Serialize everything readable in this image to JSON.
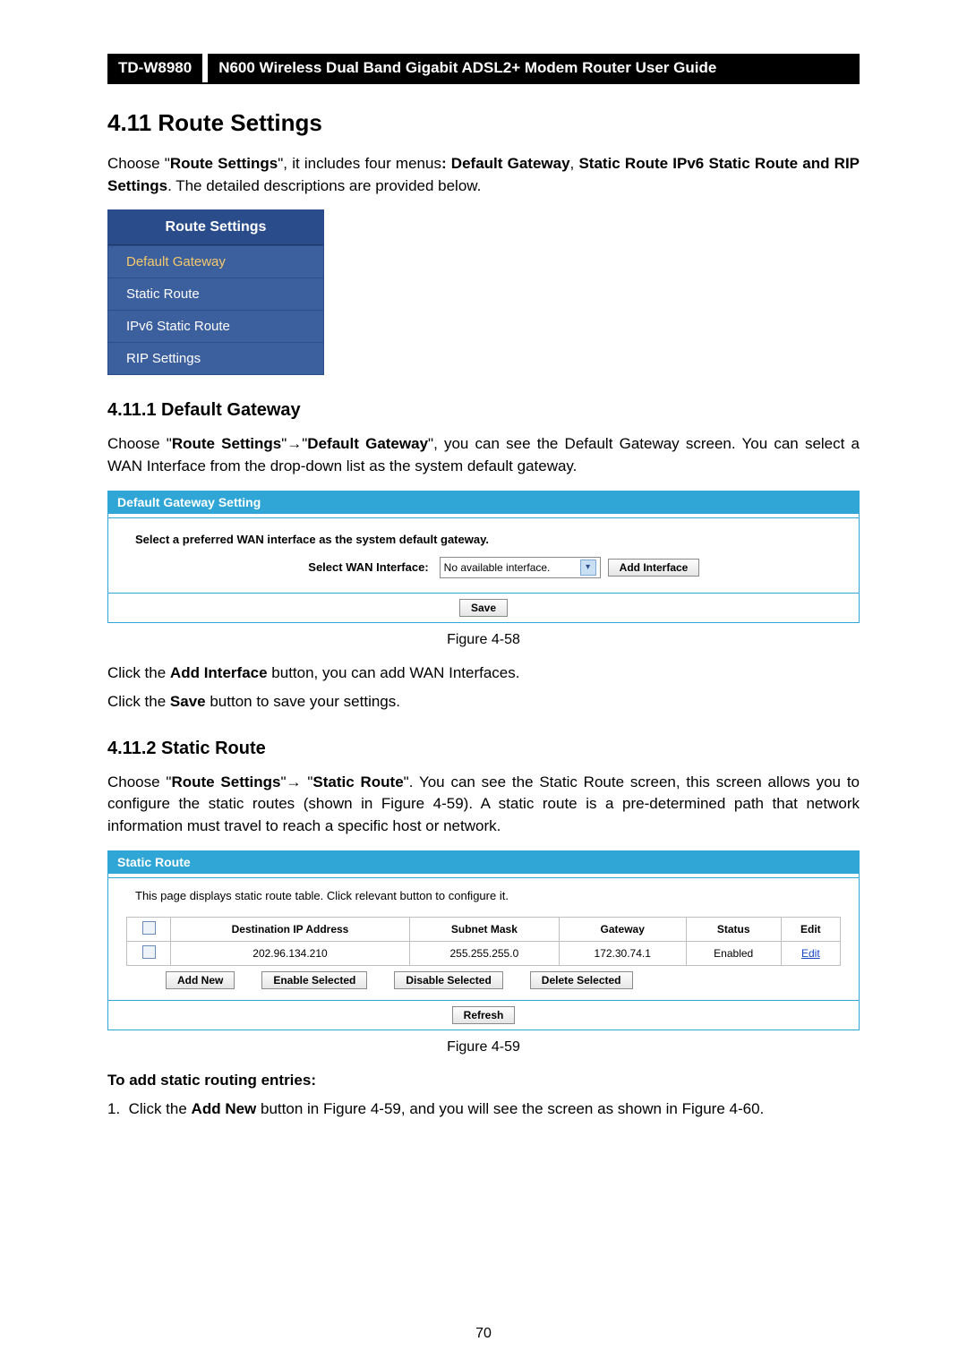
{
  "header": {
    "model": "TD-W8980",
    "title": "N600 Wireless Dual Band Gigabit ADSL2+ Modem Router User Guide"
  },
  "section_title": "4.11  Route Settings",
  "intro": {
    "pre": "Choose \"",
    "rs": "Route Settings",
    "mid": "\", it includes four menus",
    "boldlist": ": Default Gateway",
    "mid2": ", ",
    "boldlist2": "Static Route IPv6 Static Route and RIP Settings",
    "post": ". The detailed descriptions are provided below."
  },
  "nav": {
    "head": "Route Settings",
    "items": [
      "Default Gateway",
      "Static Route",
      "IPv6 Static Route",
      "RIP Settings"
    ],
    "selected": 0
  },
  "sub1": {
    "heading": "4.11.1 Default Gateway",
    "p1a": "Choose \"",
    "p1b": "Route Settings",
    "p1c": "\"→\"",
    "p1d": "Default Gateway",
    "p1e": "\", you can see the Default Gateway screen. You can select a WAN Interface from the drop-down list as the system default gateway."
  },
  "dg_panel": {
    "title": "Default Gateway Setting",
    "instruction": "Select a preferred WAN interface as the system default gateway.",
    "select_label": "Select WAN Interface:",
    "dropdown_value": "No available interface.",
    "add_interface": "Add Interface",
    "save": "Save"
  },
  "fig1": "Figure 4-58",
  "after_dg": {
    "p1a": "Click the ",
    "p1b": "Add Interface",
    "p1c": " button, you can add WAN Interfaces.",
    "p2a": "Click the ",
    "p2b": "Save",
    "p2c": " button to save your settings."
  },
  "sub2": {
    "heading": "4.11.2 Static Route",
    "p1a": "Choose \"",
    "p1b": "Route Settings",
    "p1c": "\"→ \"",
    "p1d": "Static Route",
    "p1e": "\". You can see the Static Route screen, this screen allows you to configure the static routes (shown in Figure 4-59). A static route is a pre-determined path that network information must travel to reach a specific host or network."
  },
  "sr_panel": {
    "title": "Static Route",
    "desc": "This page displays static route table. Click relevant button to configure it.",
    "headers": [
      "",
      "Destination IP Address",
      "Subnet Mask",
      "Gateway",
      "Status",
      "Edit"
    ],
    "row": {
      "dest": "202.96.134.210",
      "mask": "255.255.255.0",
      "gw": "172.30.74.1",
      "status": "Enabled",
      "edit": "Edit"
    },
    "btns": [
      "Add New",
      "Enable Selected",
      "Disable Selected",
      "Delete Selected"
    ],
    "refresh": "Refresh"
  },
  "fig2": "Figure 4-59",
  "add_static": {
    "heading": "To add static routing entries:",
    "step1a": "Click the ",
    "step1b": "Add New",
    "step1c": " button in Figure 4-59, and you will see the screen as shown in Figure 4-60."
  },
  "pagenum": "70"
}
